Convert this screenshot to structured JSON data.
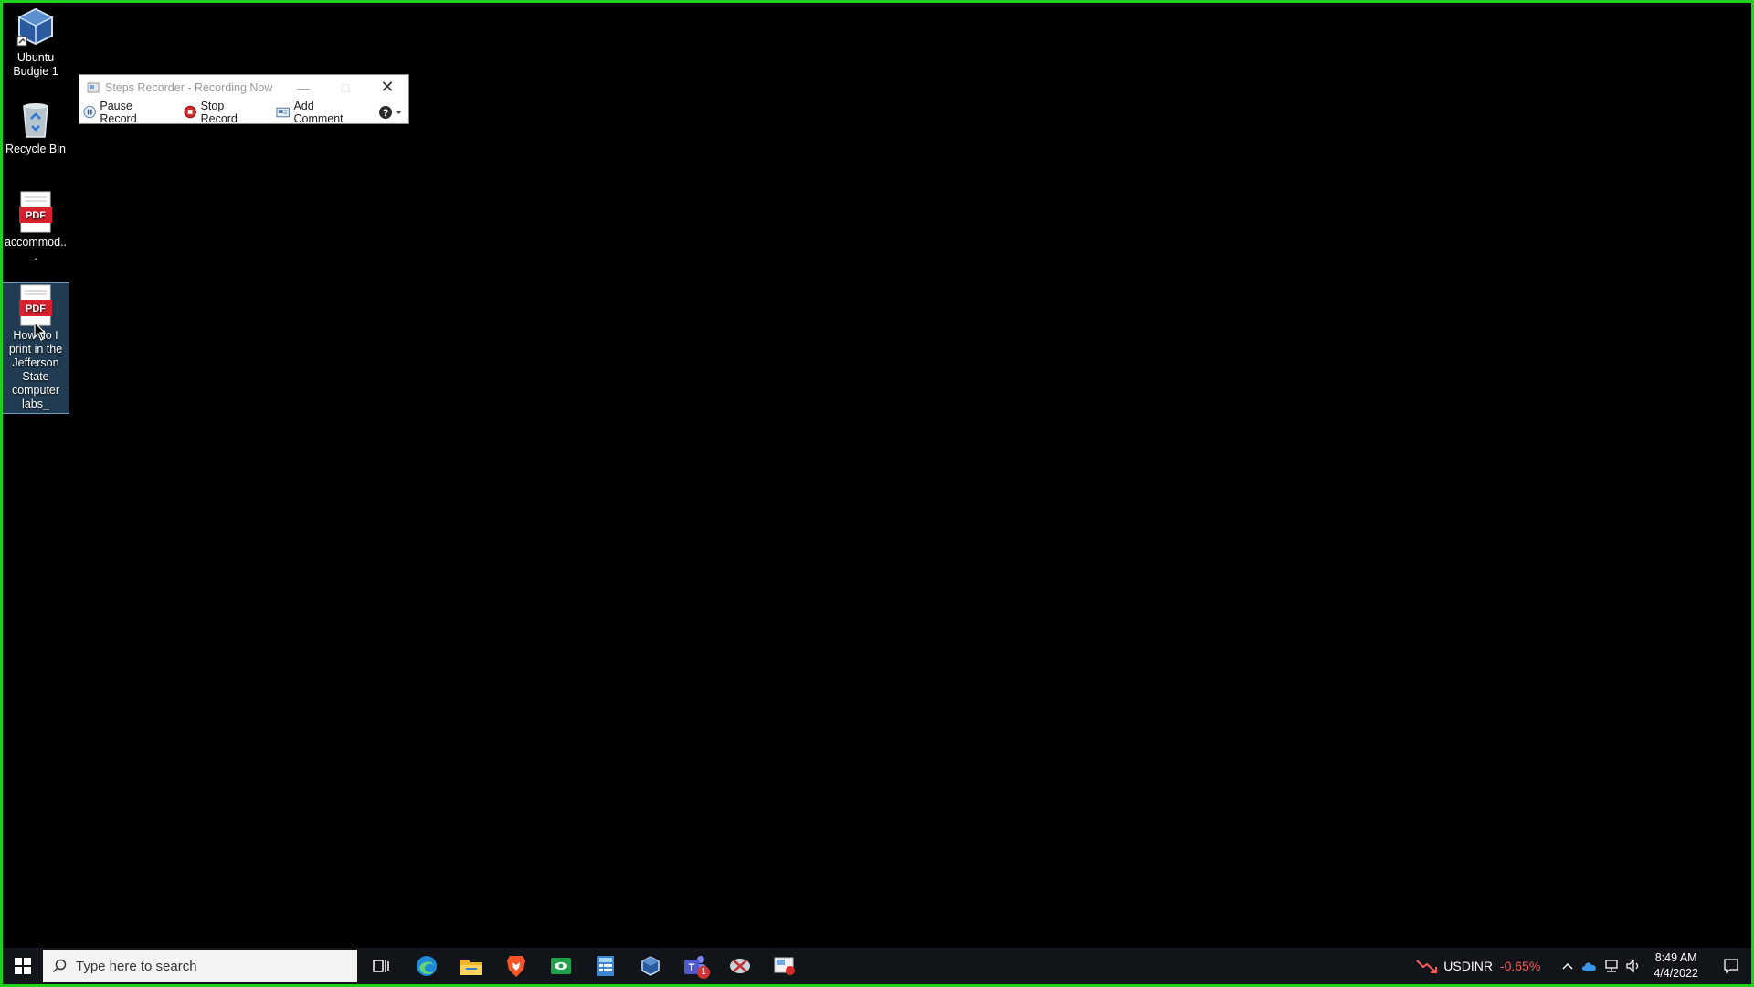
{
  "desktop": {
    "icons": [
      {
        "label": "Ubuntu Budgie 1",
        "icon": "virtualbox-vm-icon"
      },
      {
        "label": "Recycle Bin",
        "icon": "recycle-bin-icon"
      },
      {
        "label": "accommod...",
        "icon": "pdf-file-icon",
        "badge": "PDF"
      },
      {
        "label": "How do I print in the Jefferson State computer labs_",
        "icon": "pdf-file-icon",
        "badge": "PDF",
        "selected": true
      }
    ]
  },
  "steps_recorder": {
    "title": "Steps Recorder - Recording Now",
    "pause_label": "Pause Record",
    "stop_label": "Stop Record",
    "comment_label": "Add Comment"
  },
  "taskbar": {
    "search_placeholder": "Type here to search",
    "apps": [
      "task-view-icon",
      "edge-icon",
      "file-explorer-icon",
      "brave-icon",
      "camera-app-icon",
      "calculator-icon",
      "virtualbox-icon",
      "teams-icon",
      "snipping-tool-icon",
      "steps-recorder-icon"
    ],
    "teams_badge": "1",
    "currency": {
      "pair": "USDINR",
      "change": "-0.65%"
    },
    "clock": {
      "time": "8:49 AM",
      "date": "4/4/2022"
    }
  },
  "colors": {
    "screen_border": "#1fd01f",
    "currency_negative": "#ff5a5a",
    "pdf_red": "#d9202e"
  }
}
